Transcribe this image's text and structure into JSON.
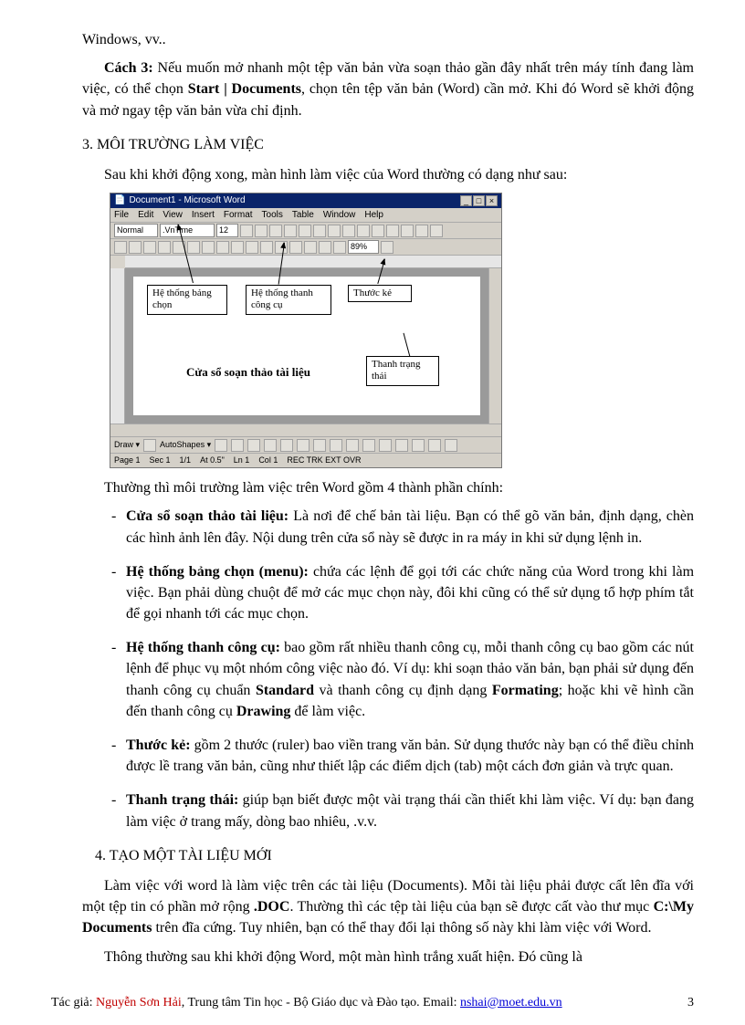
{
  "top": {
    "line1": "Windows, vv..",
    "cach3_label": "Cách 3: ",
    "cach3_a": "Nếu muốn mở nhanh một tệp văn bản vừa soạn thảo gần đây nhất trên máy tính đang làm việc, có thể chọn ",
    "cach3_b": "Start | Documents",
    "cach3_c": ", chọn tên tệp văn bản (Word) cần mở. Khi đó Word sẽ khởi động và mở ngay tệp văn bản vừa chỉ định."
  },
  "sec3": {
    "title": "3. MÔI TRƯỜNG LÀM VIỆC",
    "intro": "Sau khi khởi động xong, màn hình làm việc của Word thường có dạng như sau:",
    "after": "Thường thì môi trường làm việc trên Word gồm 4 thành phần chính:",
    "items": [
      {
        "h": "Cửa sổ soạn thảo tài liệu:",
        "t": " Là nơi để chế bản tài liệu. Bạn có thể gõ văn bản, định dạng, chèn các hình ảnh lên đây. Nội dung trên cửa sổ này sẽ được in ra máy in khi sử dụng lệnh in."
      },
      {
        "h": "Hệ thống bảng chọn (menu):",
        "t": " chứa các lệnh để gọi tới các chức năng của Word trong khi làm việc. Bạn phải dùng chuột để mở các mục chọn này, đôi khi cũng có thể sử dụng tổ hợp phím tắt để gọi nhanh tới các mục chọn."
      },
      {
        "h": "Hệ thống thanh công cụ:",
        "t1": " bao gồm rất nhiều thanh công cụ, mỗi thanh công cụ bao gồm các nút lệnh để phục vụ một nhóm công việc nào đó. Ví dụ: khi soạn thảo văn bản, bạn phải sử dụng đến thanh công cụ chuẩn ",
        "b1": "Standard",
        "t2": " và thanh công cụ định dạng ",
        "b2": "Formating",
        "t3": "; hoặc khi vẽ hình cần đến thanh công cụ ",
        "b3": "Drawing",
        "t4": " để làm việc."
      },
      {
        "h": "Thước kẻ:",
        "t": " gồm 2 thước (ruler) bao viền trang văn bản. Sử dụng thước này bạn có thể điều chỉnh được lề trang văn bản, cũng như thiết lập các điểm dịch (tab) một cách đơn giản và trực quan."
      },
      {
        "h": "Thanh trạng thái:",
        "t": " giúp bạn biết được một vài trạng thái cần thiết khi làm việc. Ví dụ: bạn đang làm việc ở trang mấy, dòng bao nhiêu, .v.v."
      }
    ]
  },
  "sec4": {
    "title": "4. TẠO MỘT TÀI LIỆU MỚI",
    "p1a": "Làm việc với word là làm việc trên các tài liệu (Documents). Mỗi tài liệu phải được cất lên đĩa với một tệp tin có phần mở rộng ",
    "p1b": ".DOC",
    "p1c": ". Thường thì các tệp tài liệu của bạn sẽ được cất vào thư mục ",
    "p1d": "C:\\My Documents",
    "p1e": " trên đĩa cứng. Tuy nhiên, bạn có thể thay đổi lại thông số này khi làm việc với Word.",
    "p2": "Thông thường sau khi khởi động Word, một màn hình trắng xuất hiện. Đó cũng là"
  },
  "shot": {
    "titlebar": "Document1 - Microsoft Word",
    "menu": [
      "File",
      "Edit",
      "View",
      "Insert",
      "Format",
      "Tools",
      "Table",
      "Window",
      "Help"
    ],
    "format": {
      "style": "Normal",
      "font": ".VnTime",
      "size": "12"
    },
    "standard": {
      "zoom": "89%"
    },
    "doc_caption": "Cửa sổ soạn thảo tài liệu",
    "drawbar": {
      "draw": "Draw ▾",
      "auto": "AutoShapes ▾"
    },
    "status": {
      "page": "Page 1",
      "sec": "Sec 1",
      "pn": "1/1",
      "at": "At 0.5\"",
      "ln": "Ln 1",
      "col": "Col 1",
      "modes": "REC TRK EXT OVR"
    },
    "call": {
      "menu": "Hệ thống bảng chọn",
      "toolbar": "Hệ thống thanh công cụ",
      "ruler": "Thước kẻ",
      "status": "Thanh trạng thái"
    }
  },
  "footer": {
    "a": "Tác giả: ",
    "author": "Nguyễn Sơn Hải",
    "b": ", Trung tâm Tin học - Bộ Giáo dục và Đào tạo. Email: ",
    "email": "nshai@moet.edu.vn",
    "page": "3"
  }
}
